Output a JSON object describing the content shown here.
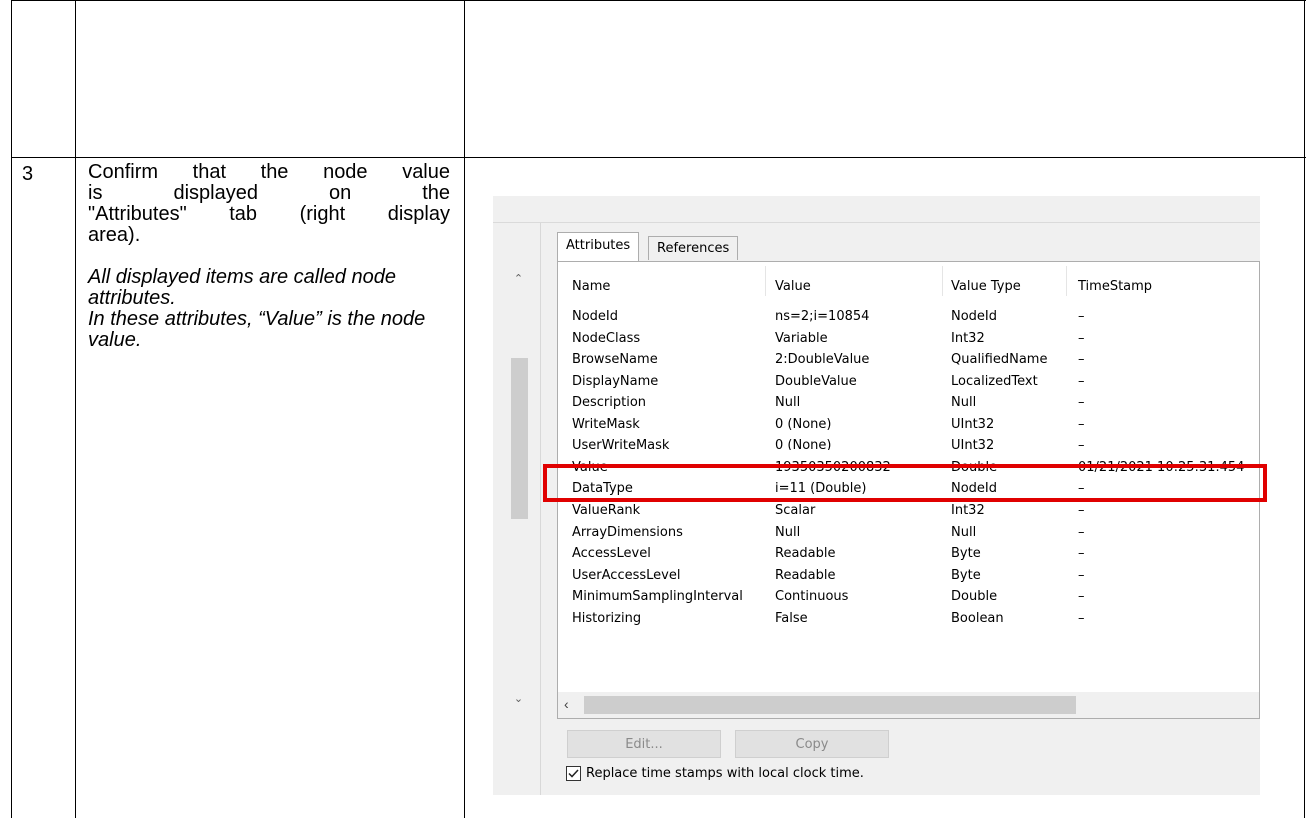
{
  "step": {
    "number": "3"
  },
  "instruction": {
    "line1": "Confirm that the node value",
    "line2": "is displayed on the",
    "line3": "\"Attributes\" tab (right display",
    "line4": "area).",
    "note1": "All displayed items are called node attributes.",
    "note2": "In these attributes, “Value” is the node value."
  },
  "tabs": {
    "attributes": "Attributes",
    "references": "References"
  },
  "columns": [
    "Name",
    "Value",
    "Value Type",
    "TimeStamp"
  ],
  "rows": [
    [
      "NodeId",
      "ns=2;i=10854",
      "NodeId",
      "–"
    ],
    [
      "NodeClass",
      "Variable",
      "Int32",
      "–"
    ],
    [
      "BrowseName",
      "2:DoubleValue",
      "QualifiedName",
      "–"
    ],
    [
      "DisplayName",
      "DoubleValue",
      "LocalizedText",
      "–"
    ],
    [
      "Description",
      "Null",
      "Null",
      "–"
    ],
    [
      "WriteMask",
      "0 (None)",
      "UInt32",
      "–"
    ],
    [
      "UserWriteMask",
      "0 (None)",
      "UInt32",
      "–"
    ],
    [
      "Value",
      "19350350200832",
      "Double",
      "01/21/2021 10:25:31.454"
    ],
    [
      "DataType",
      "i=11 (Double)",
      "NodeId",
      "–"
    ],
    [
      "ValueRank",
      "Scalar",
      "Int32",
      "–"
    ],
    [
      "ArrayDimensions",
      "Null",
      "Null",
      "–"
    ],
    [
      "AccessLevel",
      "Readable",
      "Byte",
      "–"
    ],
    [
      "UserAccessLevel",
      "Readable",
      "Byte",
      "–"
    ],
    [
      "MinimumSamplingInterval",
      "Continuous",
      "Double",
      "–"
    ],
    [
      "Historizing",
      "False",
      "Boolean",
      "–"
    ]
  ],
  "highlight_row": 7,
  "buttons": {
    "edit": "Edit...",
    "copy": "Copy"
  },
  "checkbox": {
    "label": "Replace time stamps with local clock time.",
    "checked": true
  },
  "colors": {
    "highlight": "#e00000",
    "panel_bg": "#f0f0f0",
    "scroll_thumb": "#cdcdcd"
  },
  "icons": {
    "scroll_up": "chevron-up-icon",
    "scroll_down": "chevron-down-icon",
    "scroll_left": "chevron-left-icon",
    "checkbox": "checkmark-icon"
  }
}
